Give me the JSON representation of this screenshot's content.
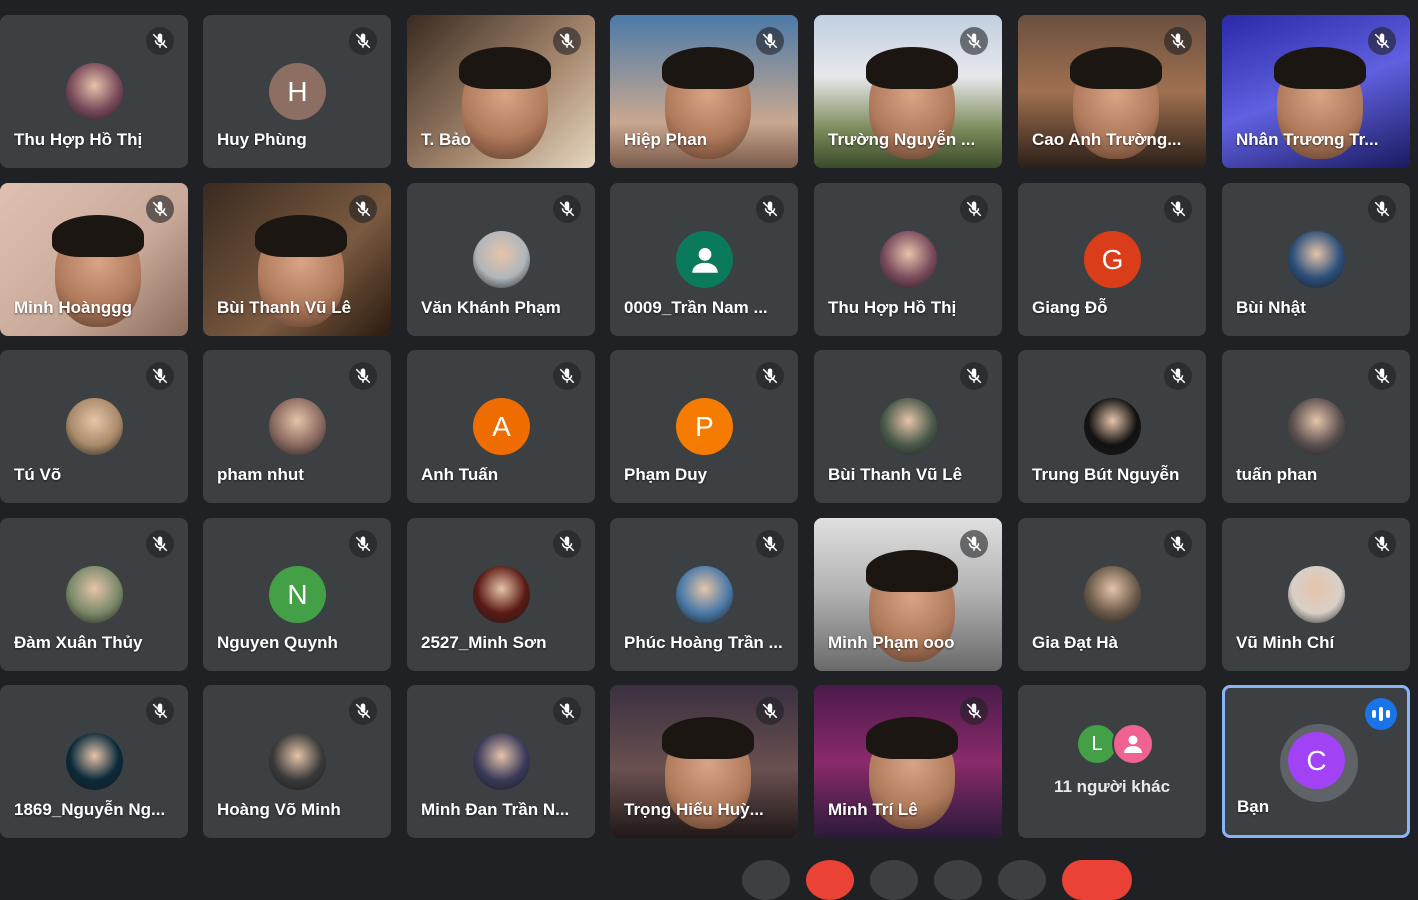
{
  "colors": {
    "background": "#202124",
    "tile": "#3c4043",
    "self_border": "#8ab4f8",
    "speaking": "#1a73e8",
    "danger": "#ea4335"
  },
  "participants": [
    {
      "name": "Thu Hợp Hồ Thị",
      "kind": "photo",
      "color": "#7a4a5c",
      "icon": "profile-photo"
    },
    {
      "name": "Huy Phùng",
      "kind": "letter",
      "letter": "H",
      "color": "#8d6e63"
    },
    {
      "name": "T. Bảo",
      "kind": "video"
    },
    {
      "name": "Hiệp Phan",
      "kind": "video"
    },
    {
      "name": "Trường Nguyễn ...",
      "kind": "video"
    },
    {
      "name": "Cao Anh Trường...",
      "kind": "video"
    },
    {
      "name": "Nhân Trương Tr...",
      "kind": "video"
    },
    {
      "name": "Minh Hoànggg",
      "kind": "video"
    },
    {
      "name": "Bùi Thanh Vũ Lê",
      "kind": "video"
    },
    {
      "name": "Văn Khánh Phạm",
      "kind": "photo",
      "color": "#b0b6bb",
      "icon": "profile-photo"
    },
    {
      "name": "0009_Trần Nam ...",
      "kind": "default",
      "color": "#0b7a5c",
      "icon": "person-icon"
    },
    {
      "name": "Thu Hợp Hồ Thị",
      "kind": "photo",
      "color": "#7a4a5c",
      "icon": "profile-photo"
    },
    {
      "name": "Giang Đỗ",
      "kind": "letter",
      "letter": "G",
      "color": "#d93d1a"
    },
    {
      "name": "Bùi Nhật",
      "kind": "photo",
      "color": "#2b4f7a",
      "icon": "profile-photo"
    },
    {
      "name": "Tú Võ",
      "kind": "photo",
      "color": "#a98a6a",
      "icon": "profile-photo"
    },
    {
      "name": "pham nhut",
      "kind": "photo",
      "color": "#8a6a60",
      "icon": "profile-photo"
    },
    {
      "name": "Anh Tuấn",
      "kind": "letter",
      "letter": "A",
      "color": "#ef6c00"
    },
    {
      "name": "Phạm Duy",
      "kind": "letter",
      "letter": "P",
      "color": "#f57c00"
    },
    {
      "name": "Bùi Thanh Vũ Lê",
      "kind": "photo",
      "color": "#4a5a4a",
      "icon": "profile-photo"
    },
    {
      "name": "Trung Bút Nguyễn",
      "kind": "photo",
      "color": "#111111",
      "icon": "profile-photo"
    },
    {
      "name": "tuấn phan",
      "kind": "photo",
      "color": "#5a5050",
      "icon": "profile-photo"
    },
    {
      "name": "Đàm Xuân Thủy",
      "kind": "photo",
      "color": "#7a8a6a",
      "icon": "profile-photo"
    },
    {
      "name": "Nguyen Quynh",
      "kind": "letter",
      "letter": "N",
      "color": "#43a047"
    },
    {
      "name": "2527_Minh Sơn",
      "kind": "photo",
      "color": "#5a1a14",
      "icon": "profile-photo"
    },
    {
      "name": "Phúc Hoàng Trần ...",
      "kind": "photo",
      "color": "#4a7aa8",
      "icon": "profile-photo"
    },
    {
      "name": "Minh Phạm ooo",
      "kind": "video"
    },
    {
      "name": "Gia Đạt Hà",
      "kind": "photo",
      "color": "#6a5a4a",
      "icon": "profile-photo"
    },
    {
      "name": "Vũ Minh Chí",
      "kind": "photo",
      "color": "#d8d0c8",
      "icon": "profile-photo"
    },
    {
      "name": "1869_Nguyễn Ng...",
      "kind": "photo",
      "color": "#0a2a3a",
      "icon": "profile-photo"
    },
    {
      "name": "Hoàng Võ Minh",
      "kind": "photo",
      "color": "#3a3a3a",
      "icon": "profile-photo"
    },
    {
      "name": "Minh Đan Trần N...",
      "kind": "photo",
      "color": "#3a3a5a",
      "icon": "profile-photo"
    },
    {
      "name": "Trọng Hiếu Huỳ...",
      "kind": "video"
    },
    {
      "name": "Minh Trí Lê",
      "kind": "video"
    }
  ],
  "others": {
    "label": "11 người khác",
    "avatars": [
      {
        "letter": "L",
        "color": "#43a047"
      },
      {
        "letter": "",
        "color": "#f06292",
        "icon": "person-icon"
      }
    ]
  },
  "self": {
    "name": "Bạn",
    "letter": "C",
    "color": "#a142f4",
    "icon": "speaking-indicator-icon"
  }
}
